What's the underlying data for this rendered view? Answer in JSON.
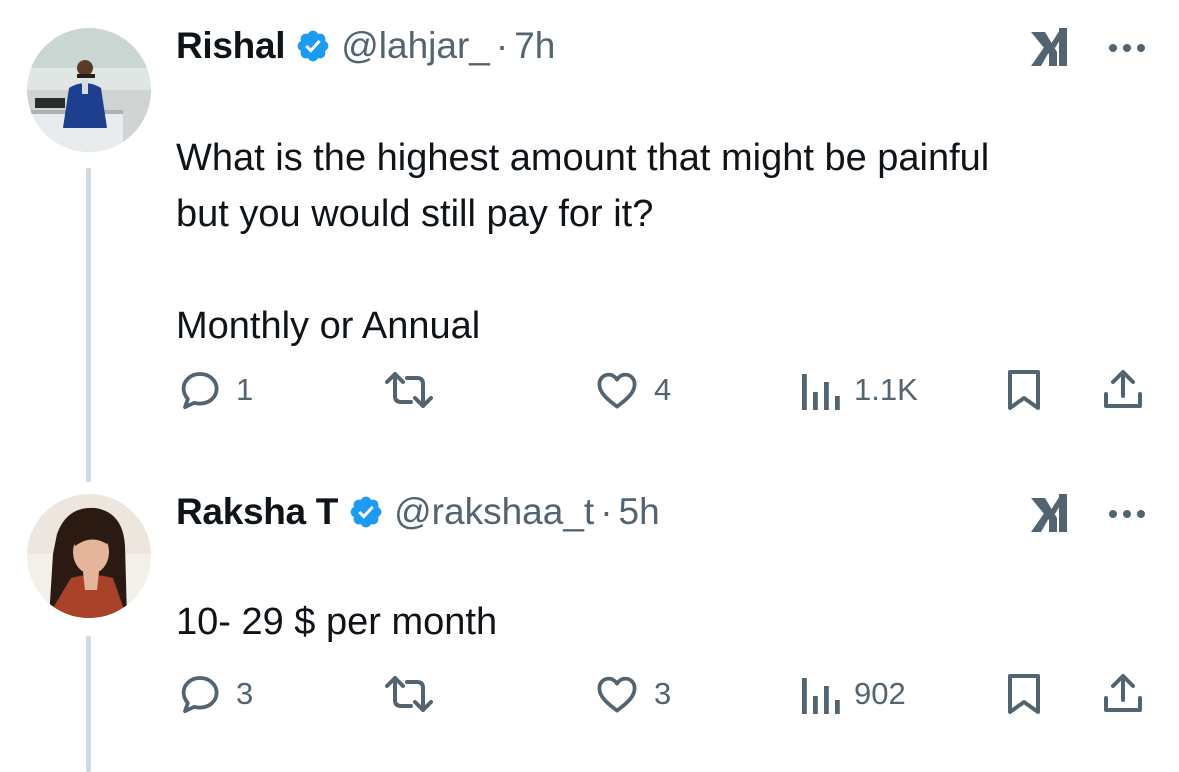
{
  "tweets": [
    {
      "name": "Rishal",
      "handle": "@lahjar_",
      "separator": "·",
      "time": "7h",
      "text": "What is the highest amount that might be painful\nbut you would still pay for it?\n\nMonthly or Annual",
      "replies": "1",
      "retweets": "",
      "likes": "4",
      "views": "1.1K"
    },
    {
      "name": "Raksha T",
      "handle": "@rakshaa_t",
      "separator": "·",
      "time": "5h",
      "text": "10- 29 $ per month",
      "replies": "3",
      "retweets": "",
      "likes": "3",
      "views": "902"
    }
  ],
  "icons": {
    "verified": "verified-badge-icon",
    "grok": "grok-icon",
    "more": "more-icon",
    "reply": "reply-icon",
    "retweet": "retweet-icon",
    "like": "heart-icon",
    "views": "views-icon",
    "bookmark": "bookmark-icon",
    "share": "share-icon"
  },
  "colors": {
    "verified_blue": "#1d9bf0",
    "secondary_text": "#536471",
    "thread_line": "#cfd9de",
    "primary_text": "#0f1419"
  }
}
